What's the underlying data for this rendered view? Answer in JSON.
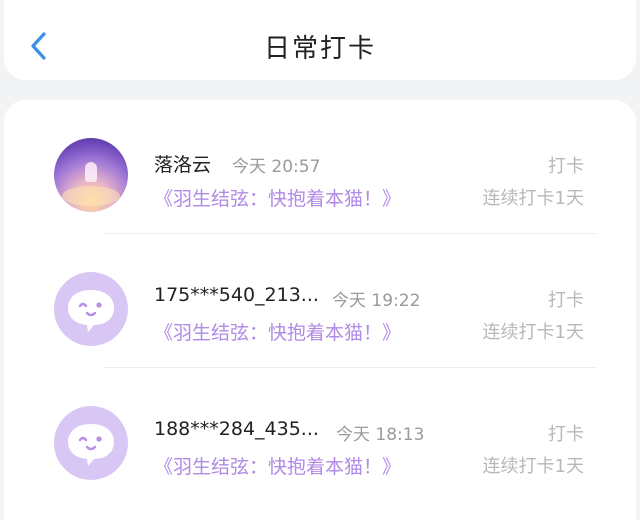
{
  "header": {
    "title": "日常打卡",
    "back_icon": "chevron-left-icon",
    "back_color": "#3d8ee8"
  },
  "checkins": [
    {
      "name": "落洛云",
      "time": "今天 20:57",
      "book": "《羽生结弦：快抱着本猫！》",
      "label": "打卡",
      "streak": "连续打卡1天",
      "avatar": "photo"
    },
    {
      "name": "175***540_213...",
      "time": "今天 19:22",
      "book": "《羽生结弦：快抱着本猫！》",
      "label": "打卡",
      "streak": "连续打卡1天",
      "avatar": "default-chat-bubble"
    },
    {
      "name": "188***284_435...",
      "time": "今天 18:13",
      "book": "《羽生结弦：快抱着本猫！》",
      "label": "打卡",
      "streak": "连续打卡1天",
      "avatar": "default-chat-bubble"
    }
  ],
  "colors": {
    "accent_purple": "#b08ae6",
    "avatar_default_bg": "#d8c7f5",
    "muted_text": "#b8b8b8"
  }
}
